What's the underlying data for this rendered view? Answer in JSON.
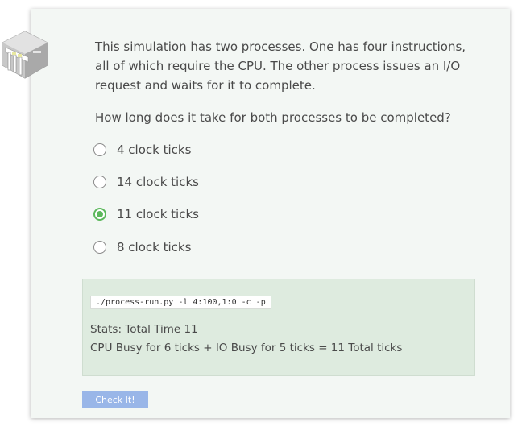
{
  "question": {
    "text": "This simulation has two processes. One has four instructions, all of which require the CPU. The other process issues an I/O request and waits for it to complete.",
    "prompt": "How long does it take for both processes to be completed?"
  },
  "options": [
    {
      "label": "4 clock ticks",
      "selected": false
    },
    {
      "label": "14 clock ticks",
      "selected": false
    },
    {
      "label": "11 clock ticks",
      "selected": true
    },
    {
      "label": "8 clock ticks",
      "selected": false
    }
  ],
  "result": {
    "command": "./process-run.py -l 4:100,1:0 -c -p",
    "stats_line1": "Stats: Total Time 11",
    "stats_line2": "CPU Busy for 6 ticks + IO Busy for 5 ticks = 11 Total ticks"
  },
  "check_button_label": "Check It!",
  "colors": {
    "card_background": "#f3f7f4",
    "result_background": "#deebdf",
    "selected_radio": "#5cb85c",
    "button": "#99b6e8"
  },
  "icons": {
    "logo": "building-column-logo"
  }
}
